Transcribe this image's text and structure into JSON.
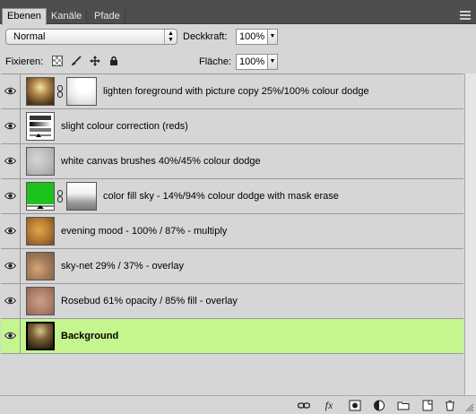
{
  "tabs": [
    {
      "label": "Ebenen",
      "active": true
    },
    {
      "label": "Kanäle",
      "active": false
    },
    {
      "label": "Pfade",
      "active": false
    }
  ],
  "options": {
    "blend_mode": "Normal",
    "opacity_label": "Deckkraft:",
    "opacity_value": "100%",
    "lock_label": "Fixieren:",
    "fill_label": "Fläche:",
    "fill_value": "100%"
  },
  "layers": [
    {
      "name": "lighten foreground with picture copy 25%/100% colour dodge",
      "visible": true,
      "has_mask": true,
      "thumb": "photo-forest",
      "selected": false
    },
    {
      "name": "slight colour correction (reds)",
      "visible": true,
      "has_mask": false,
      "thumb": "adjustment-levels",
      "selected": false
    },
    {
      "name": "white canvas brushes 40%/45% colour dodge",
      "visible": true,
      "has_mask": false,
      "thumb": "texture-grey",
      "selected": false
    },
    {
      "name": "color fill sky - 14%/94% colour dodge with mask erase",
      "visible": true,
      "has_mask": true,
      "thumb": "fill-green",
      "selected": false
    },
    {
      "name": "evening mood - 100% / 87% - multiply",
      "visible": true,
      "has_mask": false,
      "thumb": "texture-orange",
      "selected": false
    },
    {
      "name": "sky-net 29% / 37% - overlay",
      "visible": true,
      "has_mask": false,
      "thumb": "texture-warm",
      "selected": false
    },
    {
      "name": "Rosebud 61% opacity / 85% fill - overlay",
      "visible": true,
      "has_mask": false,
      "thumb": "texture-rose",
      "selected": false
    },
    {
      "name": "Background",
      "visible": true,
      "has_mask": false,
      "thumb": "photo-forest-dark",
      "selected": true
    }
  ],
  "bottom_icons": [
    "link-icon",
    "fx-icon",
    "add-mask-icon",
    "adjustment-layer-icon",
    "folder-icon",
    "new-layer-icon",
    "trash-icon"
  ],
  "colors": {
    "selected_row": "#c4f58f",
    "panel_bg": "#d6d6d6",
    "tabbar_bg": "#4e4e4e",
    "fill_green": "#1ec21e"
  }
}
